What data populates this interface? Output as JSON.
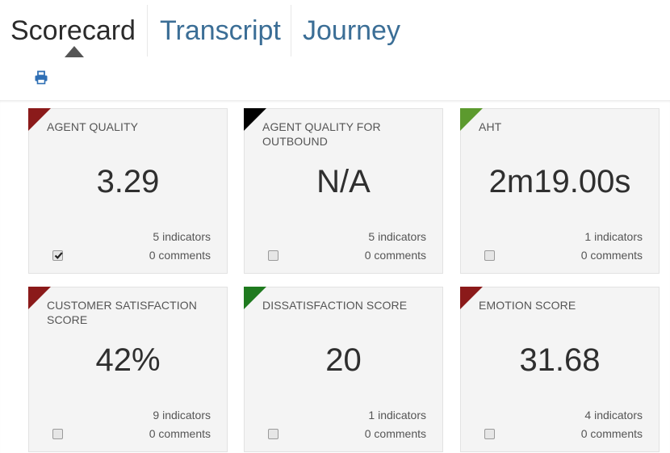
{
  "tabs": [
    {
      "label": "Scorecard",
      "active": true
    },
    {
      "label": "Transcript",
      "active": false
    },
    {
      "label": "Journey",
      "active": false
    }
  ],
  "toolbar": {
    "print_icon": "print-icon"
  },
  "colors": {
    "tab_link": "#3b6e96",
    "tab_active": "#2b2b2b",
    "flag_red": "#8b1a1a",
    "flag_black": "#000000",
    "flag_green_light": "#5c9a2e",
    "flag_green": "#1f7a1f",
    "card_bg": "#f4f4f4"
  },
  "cards": [
    {
      "title": "AGENT QUALITY",
      "value": "3.29",
      "indicators": "5 indicators",
      "comments": "0 comments",
      "checked": true,
      "flag": "red"
    },
    {
      "title": "AGENT QUALITY FOR OUTBOUND",
      "value": "N/A",
      "indicators": "5 indicators",
      "comments": "0 comments",
      "checked": false,
      "flag": "black"
    },
    {
      "title": "AHT",
      "value": "2m19.00s",
      "indicators": "1 indicators",
      "comments": "0 comments",
      "checked": false,
      "flag": "green-light"
    },
    {
      "title": "CUSTOMER SATISFACTION SCORE",
      "value": "42%",
      "indicators": "9 indicators",
      "comments": "0 comments",
      "checked": false,
      "flag": "red"
    },
    {
      "title": "DISSATISFACTION SCORE",
      "value": "20",
      "indicators": "1 indicators",
      "comments": "0 comments",
      "checked": false,
      "flag": "green"
    },
    {
      "title": "EMOTION SCORE",
      "value": "31.68",
      "indicators": "4 indicators",
      "comments": "0 comments",
      "checked": false,
      "flag": "red"
    }
  ]
}
